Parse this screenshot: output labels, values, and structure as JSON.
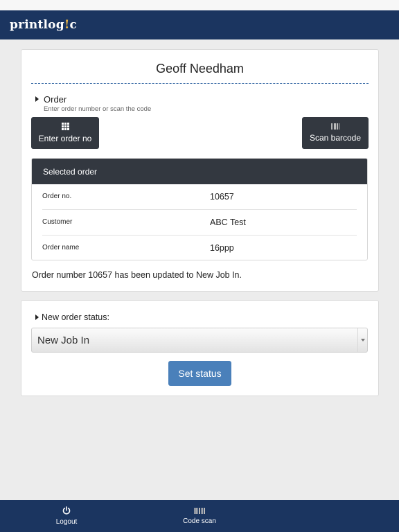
{
  "header": {
    "logo_main": "printlog",
    "logo_dot": "!",
    "logo_tail": "c"
  },
  "user": {
    "name": "Geoff Needham"
  },
  "order_section": {
    "label": "Order",
    "hint": "Enter order number or scan the code",
    "enter_button": "Enter order no",
    "enter_icon": "keypad-icon",
    "scan_button": "Scan barcode",
    "scan_icon": "barcode-icon"
  },
  "selected_order": {
    "heading": "Selected order",
    "rows": [
      {
        "key": "Order no.",
        "value": "10657"
      },
      {
        "key": "Customer",
        "value": "ABC Test"
      },
      {
        "key": "Order name",
        "value": "16ppp"
      }
    ]
  },
  "message": "Order number 10657 has been updated to New Job In.",
  "status_section": {
    "label": "New order status:",
    "selected": "New Job In",
    "button": "Set status"
  },
  "footer": {
    "items": [
      {
        "label": "Logout",
        "icon": "power-icon"
      },
      {
        "label": "Code scan",
        "icon": "barcode-icon"
      }
    ]
  },
  "colors": {
    "header_bg": "#1b3560",
    "dark_button": "#333840",
    "primary_button": "#4a80ba",
    "logo_accent": "#e7b343"
  }
}
